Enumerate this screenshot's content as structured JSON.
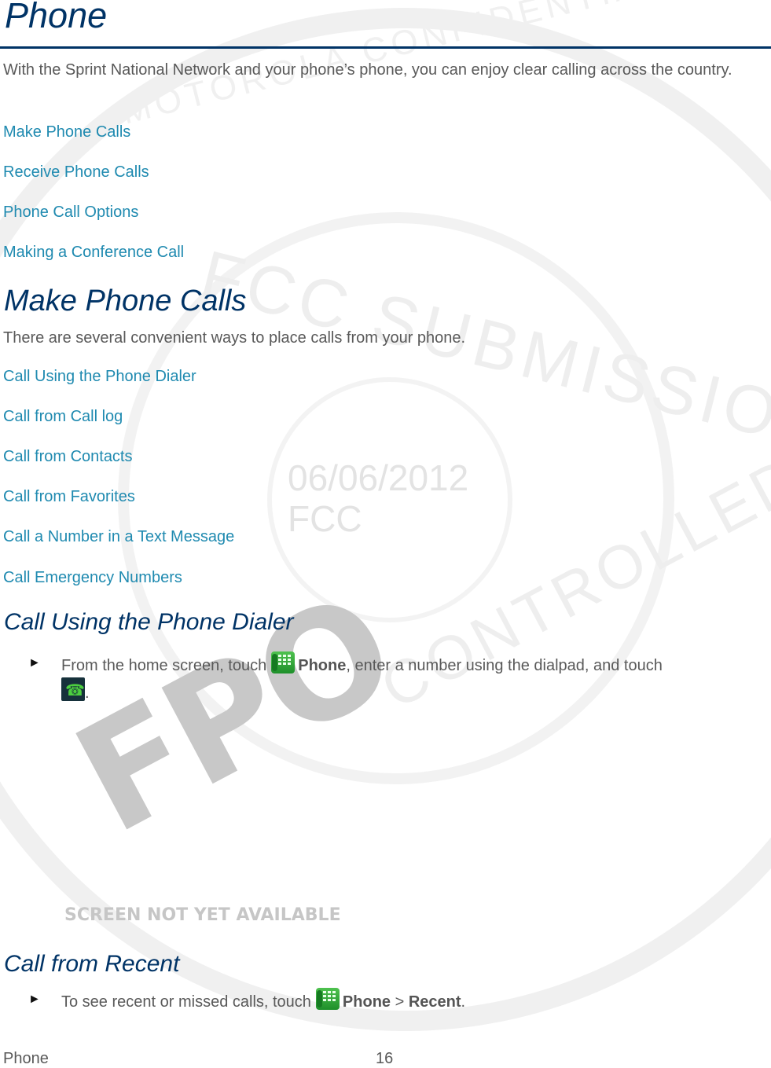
{
  "page": {
    "title": "Phone",
    "intro": "With the Sprint National Network and your phone’s phone, you can enjoy clear calling across the country.",
    "toc_links": [
      "Make Phone Calls",
      "Receive Phone Calls",
      "Phone Call Options",
      "Making a Conference Call"
    ]
  },
  "make_calls": {
    "heading": "Make Phone Calls",
    "intro": "There are several convenient ways to place calls from your phone.",
    "links": [
      "Call Using the Phone Dialer",
      "Call from Call log",
      "Call from Contacts",
      "Call from Favorites",
      "Call a Number in a Text Message",
      "Call Emergency Numbers"
    ]
  },
  "dialer": {
    "heading": "Call Using the Phone Dialer",
    "bullet": "►",
    "step_prefix": "From the home screen, touch",
    "step_icon": "phone-app-icon",
    "step_bold": "Phone",
    "step_middle": ", enter a number using the dialpad, and touch",
    "step_end_icon": "call-button-icon",
    "step_end": ".",
    "placeholder_main": "FPO",
    "placeholder_caption": "SCREEN NOT YET AVAILABLE"
  },
  "recent": {
    "heading": "Call from Recent",
    "bullet": "►",
    "step_prefix": "To see recent or missed calls, touch",
    "step_icon": "phone-app-icon",
    "step_bold1": "Phone",
    "step_sep": " > ",
    "step_bold2": "Recent",
    "step_end": "."
  },
  "watermark": {
    "line1": "06/06/2012",
    "line2": "FCC",
    "ring_text_top": "FCC SUBMISSION",
    "ring_text_bottom": "CONTROLLED",
    "outer_text": "MOTOROLA CONFIDENTIAL RESTRICTED"
  },
  "footer": {
    "section": "Phone",
    "page_number": "16"
  }
}
